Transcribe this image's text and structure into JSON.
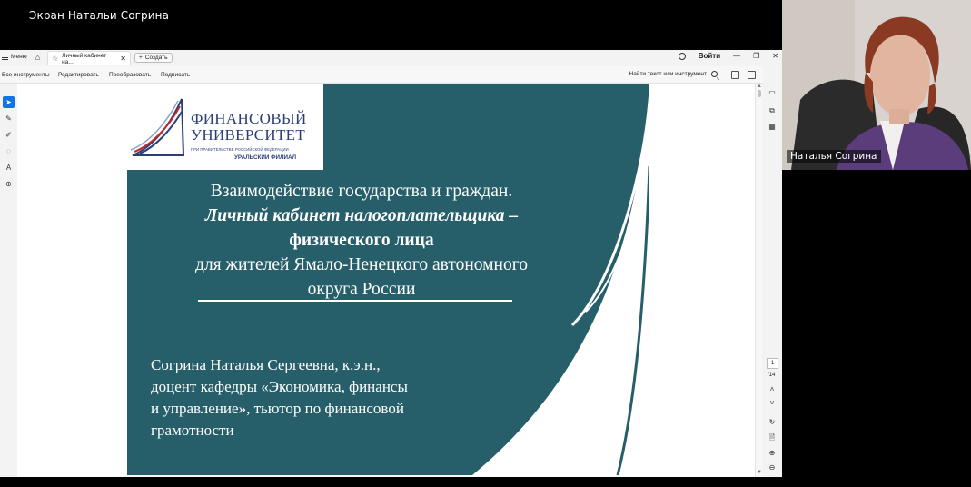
{
  "meeting": {
    "share_title": "Экран Натальи Согрина",
    "participant_name": "Наталья Согрина"
  },
  "browser": {
    "menu_label": "Меню",
    "tab_title": "Личный кабинет на...",
    "new_tab_label": "Создать",
    "sign_in_label": "Войти"
  },
  "toolbar": {
    "all_tools": "Все инструменты",
    "edit": "Редактировать",
    "convert": "Преобразовать",
    "sign": "Подписать",
    "find_placeholder": "Найти текст или инструмент"
  },
  "pager": {
    "current_page": "1",
    "total_pages": "/14"
  },
  "slide": {
    "logo": {
      "line1": "ФИНАНСОВЫЙ",
      "line2": "УНИВЕРСИТЕТ",
      "line3": "ПРИ ПРАВИТЕЛЬСТВЕ РОССИЙСКОЙ ФЕДЕРАЦИИ",
      "line4": "УРАЛЬСКИЙ ФИЛИАЛ"
    },
    "title_line1": "Взаимодействие государства и граждан.",
    "title_line2": "Личный кабинет налогоплательщика –",
    "title_line3": "физического лица",
    "title_line4": "для жителей Ямало-Ненецкого автономного",
    "title_line5": "округа России",
    "author_line1": "Согрина Наталья Сергеевна, к.э.н.,",
    "author_line2": "доцент кафедры «Экономика, финансы",
    "author_line3": "и управление», тьютор по финансовой",
    "author_line4": "грамотности"
  },
  "colors": {
    "slide_bg": "#265e69",
    "logo_blue": "#2a3e78",
    "accent_active": "#1473e6"
  }
}
